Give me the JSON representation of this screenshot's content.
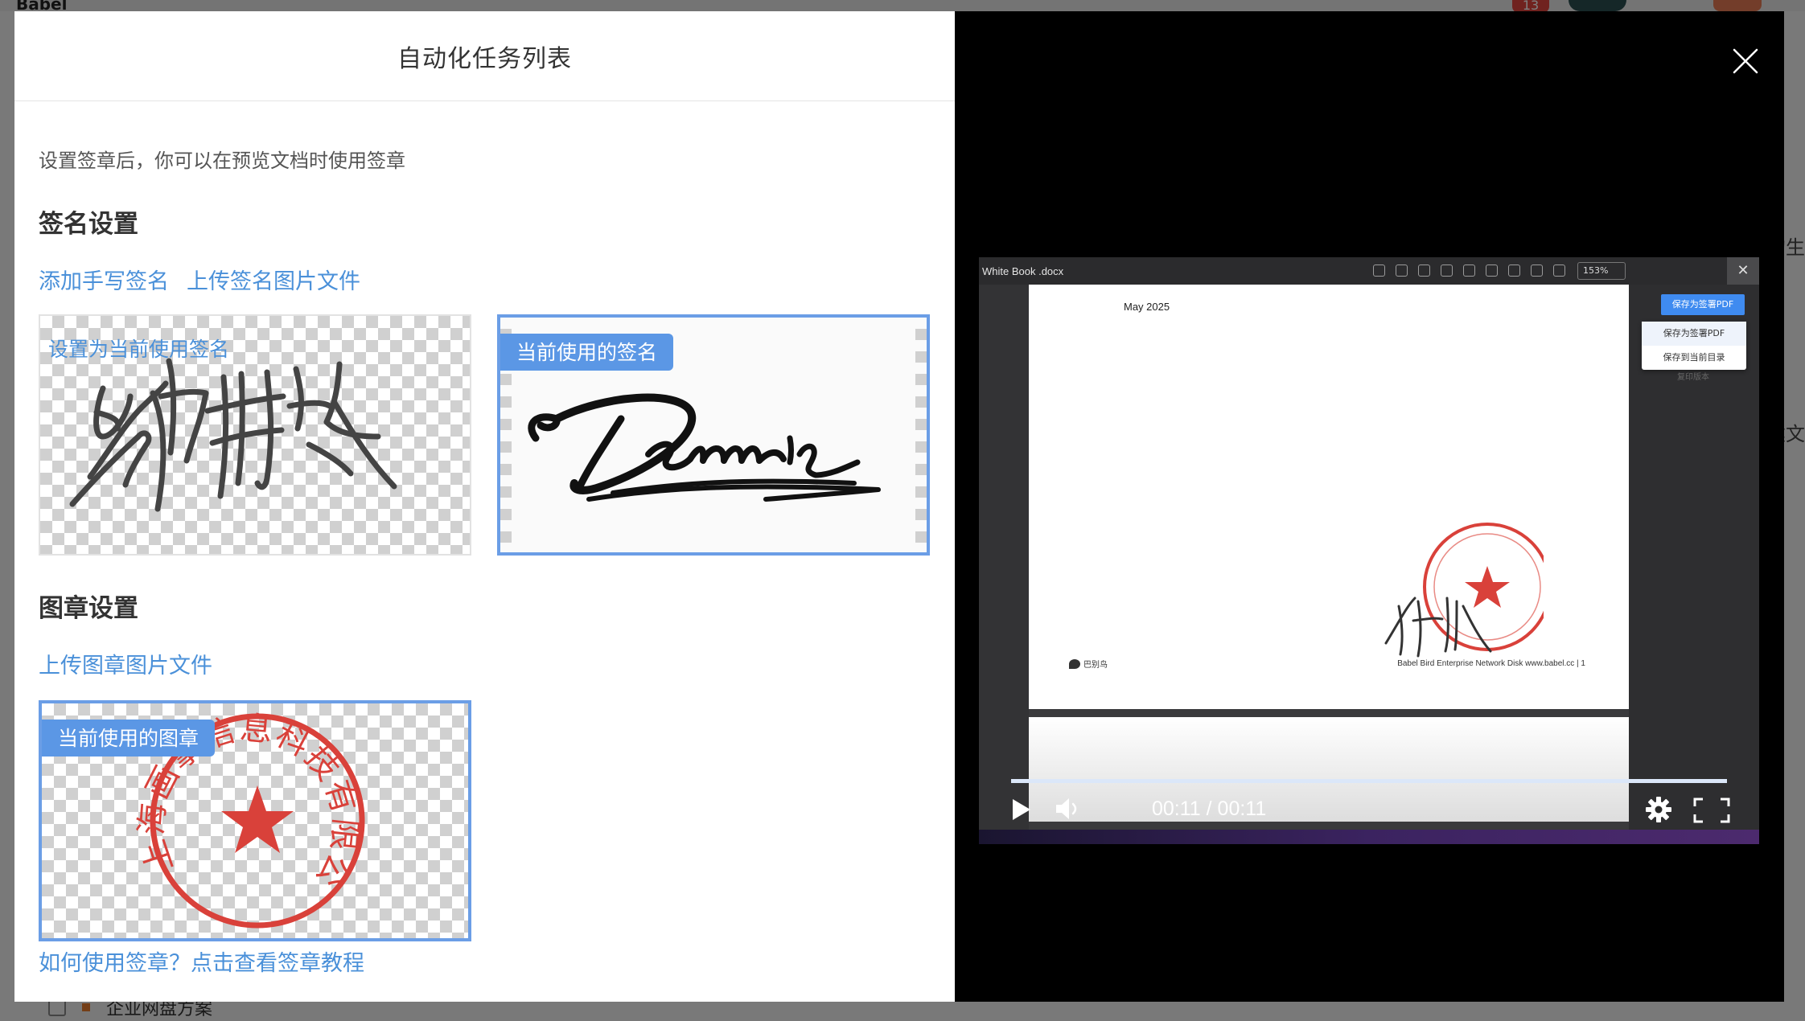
{
  "background": {
    "brand": "Babel",
    "badge_count": "13",
    "side_text_1": "的生",
    "side_text_2": "建文",
    "bottom_row_label": "企业网盘方案"
  },
  "modal": {
    "title": "自动化任务列表",
    "description": "设置签章后，你可以在预览文档时使用签章",
    "signature": {
      "section_title": "签名设置",
      "add_handwritten": "添加手写签名",
      "upload_image": "上传签名图片文件",
      "set_current_link": "设置为当前使用签名",
      "current_tag": "当前使用的签名",
      "signature_text": "Dennis"
    },
    "stamp": {
      "section_title": "图章设置",
      "upload_image": "上传图章图片文件",
      "current_tag": "当前使用的图章",
      "stamp_text": "上海画擎信息科技有限公司"
    },
    "help_link": "如何使用签章？点击查看签章教程"
  },
  "video": {
    "file_name": "White Book .docx",
    "zoom": "153%",
    "doc_date": "May 2025",
    "doc_footer": "Babel  Bird  Enterprise  Network  Disk  www.babel.cc  |  1",
    "doc_logo": "巴别鸟",
    "save_pdf_button": "保存为签署PDF",
    "dropdown_items": [
      "保存为签署PDF",
      "保存到当前目录"
    ],
    "faded_text": "复印版本",
    "time_display": "00:11 / 00:11",
    "progress_fraction": 1.0
  },
  "colors": {
    "accent": "#4a90d9",
    "tag_bg": "#5b97e5",
    "stamp_red": "#d9413a"
  }
}
